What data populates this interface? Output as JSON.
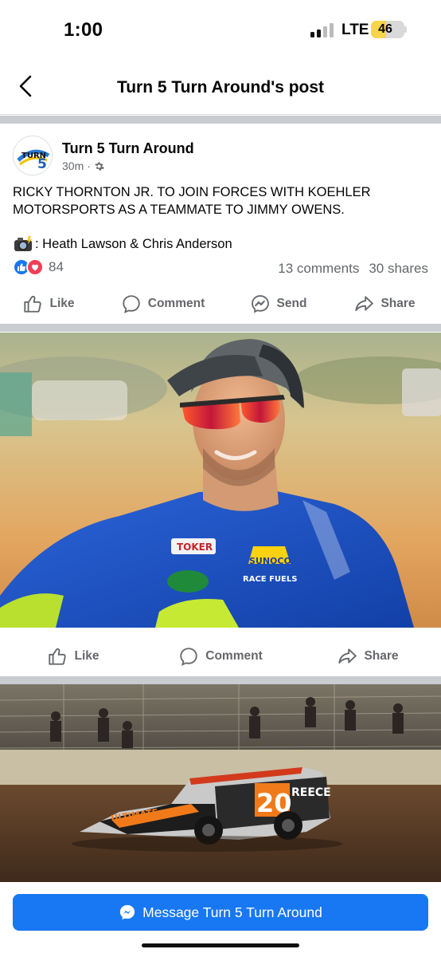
{
  "status_bar": {
    "time": "1:00",
    "network": "LTE",
    "battery": "46",
    "battery_level": 0.46
  },
  "header": {
    "title": "Turn 5 Turn Around's post"
  },
  "post": {
    "page_name": "Turn 5 Turn Around",
    "avatar_text": "TURN 5",
    "time_ago": "30m",
    "text": "RICKY THORNTON JR. TO JOIN FORCES WITH KOEHLER MOTORSPORTS AS A TEAMMATE TO JIMMY OWENS.",
    "credit": ": Heath Lawson & Chris Anderson",
    "reaction_count": "84",
    "comments": "13 comments",
    "shares": "30 shares"
  },
  "actions": {
    "like": "Like",
    "comment": "Comment",
    "send": "Send",
    "share": "Share"
  },
  "photo1": {
    "patch_brand": "TOKER",
    "sponsor": "SUNOCO",
    "sponsor_sub": "RACE FUELS"
  },
  "photo1_actions": {
    "like": "Like",
    "comment": "Comment",
    "share": "Share"
  },
  "photo2": {
    "car_number": "20",
    "sponsor_side": "ULTIMATE",
    "sponsor_roof": "REECE"
  },
  "message_button": {
    "label": "Message Turn 5 Turn Around"
  },
  "colors": {
    "facebook_blue": "#1877f2",
    "secondary_text": "#65676b",
    "love_red": "#f33e58"
  }
}
